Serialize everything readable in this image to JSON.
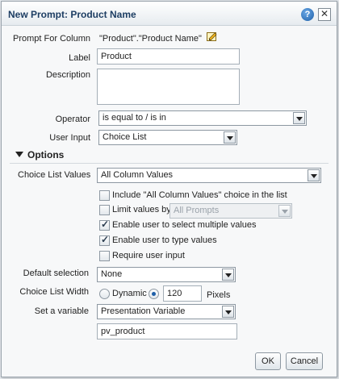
{
  "dialog": {
    "title": "New Prompt: Product Name",
    "help_label": "?",
    "close_label": "✕"
  },
  "prompt_for_column": {
    "label": "Prompt For Column",
    "value": "\"Product\".\"Product Name\""
  },
  "label_field": {
    "label": "Label",
    "value": "Product"
  },
  "description_field": {
    "label": "Description",
    "value": ""
  },
  "operator": {
    "label": "Operator",
    "selected": "is equal to / is in"
  },
  "user_input": {
    "label": "User Input",
    "selected": "Choice List"
  },
  "options": {
    "heading": "Options",
    "choice_list_values": {
      "label": "Choice List Values",
      "selected": "All Column Values"
    },
    "checkboxes": [
      {
        "label": "Include \"All Column Values\" choice in the list",
        "checked": false
      },
      {
        "label": "Limit values by",
        "checked": false
      },
      {
        "label": "Enable user to select multiple values",
        "checked": true
      },
      {
        "label": "Enable user to type values",
        "checked": true
      },
      {
        "label": "Require user input",
        "checked": false
      }
    ],
    "limit_values_select": "All Prompts",
    "default_selection": {
      "label": "Default selection",
      "selected": "None"
    },
    "choice_list_width": {
      "label": "Choice List Width",
      "dynamic_label": "Dynamic",
      "width_value": "120",
      "unit": "Pixels",
      "selected_option": "pixels"
    },
    "set_variable": {
      "label": "Set a variable",
      "selected": "Presentation Variable",
      "variable_name": "pv_product"
    }
  },
  "buttons": {
    "ok": "OK",
    "cancel": "Cancel"
  },
  "icons": {
    "help": "help-icon",
    "close": "close-icon",
    "edit": "edit-icon",
    "expand": "collapse-triangle-icon"
  }
}
